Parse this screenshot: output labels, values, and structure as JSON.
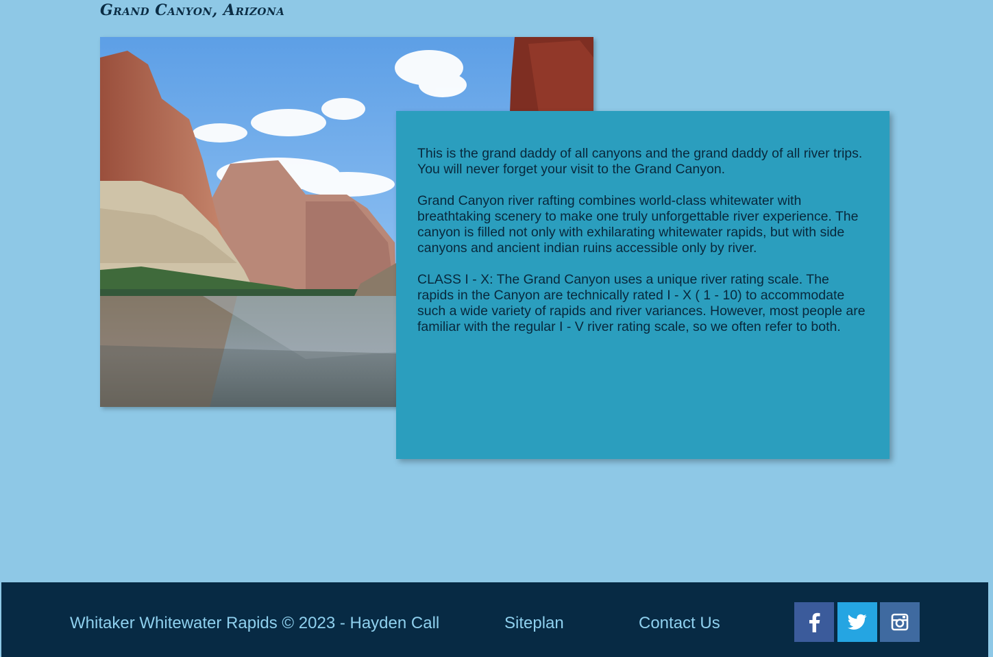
{
  "page": {
    "title": "Grand Canyon, Arizona"
  },
  "photo": {
    "subject": "grand-canyon-river-photo"
  },
  "info": {
    "paragraphs": [
      "This is the grand daddy of all canyons and the grand daddy of all river trips. You will never forget your visit to the Grand Canyon.",
      "Grand Canyon river rafting combines world-class whitewater with breathtaking scenery to make one truly unforgettable river experience. The canyon is filled not only with exhilarating whitewater rapids, but with side canyons and ancient indian ruins accessible only by river.",
      "CLASS I - X: The Grand Canyon uses a unique river rating scale. The rapids in the Canyon are technically rated I - X ( 1 - 10) to accommodate such a wide variety of rapids and river variances. However, most people are familiar with the regular I - V river rating scale, so we often refer to both."
    ]
  },
  "footer": {
    "copyright": "Whitaker Whitewater Rapids © 2023 - Hayden Call",
    "links": {
      "siteplan": "Siteplan",
      "contact": "Contact Us"
    },
    "social": [
      {
        "name": "facebook",
        "icon": "facebook-icon",
        "color": "#3b5b9b"
      },
      {
        "name": "twitter",
        "icon": "twitter-icon",
        "color": "#25a5e2"
      },
      {
        "name": "instagram",
        "icon": "instagram-icon",
        "color": "#3f6aa0"
      }
    ]
  },
  "colors": {
    "background": "#8ec8e6",
    "card": "#2b9ebe",
    "footer": "#072a44",
    "footer_text": "#8fd0ee",
    "title": "#0b2d45"
  }
}
